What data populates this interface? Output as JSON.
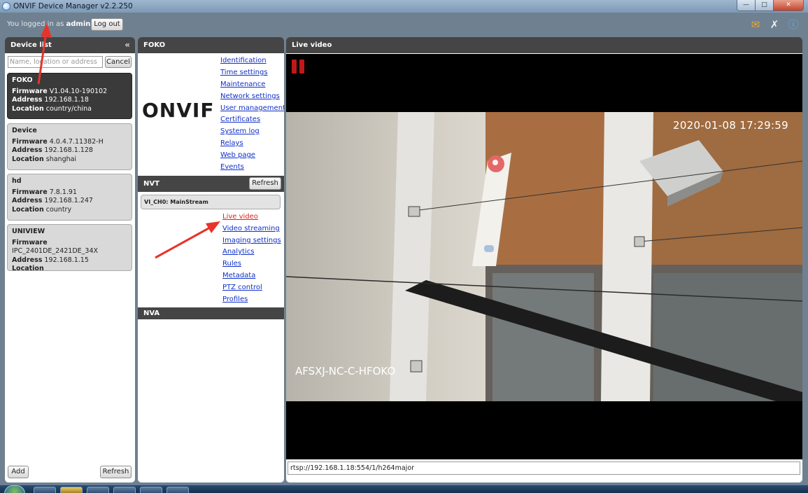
{
  "window": {
    "title": "ONVIF Device Manager v2.2.250"
  },
  "login": {
    "prefix": "You logged in as",
    "user": "admin",
    "logout_label": "Log out"
  },
  "device_list": {
    "header": "Device list",
    "search_placeholder": "Name, location or address",
    "cancel_label": "Cancel",
    "devices": [
      {
        "name": "FOKO",
        "firmware": "V1.04.10-190102",
        "address": "192.168.1.18",
        "location": "country/china"
      },
      {
        "name": "Device",
        "firmware": "4.0.4.7.11382-H",
        "address": "192.168.1.128",
        "location": "shanghai"
      },
      {
        "name": "hd",
        "firmware": "7.8.1.91",
        "address": "192.168.1.247",
        "location": "country"
      },
      {
        "name": "UNIVIEW",
        "firmware": "IPC_2401DE_2421DE_34X",
        "address": "192.168.1.15",
        "location": ""
      }
    ],
    "field_labels": {
      "firmware": "Firmware",
      "address": "Address",
      "location": "Location"
    },
    "add_label": "Add",
    "refresh_label": "Refresh"
  },
  "device_panel": {
    "header": "FOKO",
    "logo_text": "ONVIF",
    "menu": [
      "Identification",
      "Time settings",
      "Maintenance",
      "Network settings",
      "User management",
      "Certificates",
      "System log",
      "Relays",
      "Web page",
      "Events"
    ],
    "nvt_header": "NVT",
    "nvt_refresh_label": "Refresh",
    "stream_name": "VI_CH0: MainStream",
    "stream_menu": [
      "Live video",
      "Video streaming",
      "Imaging settings",
      "Analytics",
      "Rules",
      "Metadata",
      "PTZ control",
      "Profiles"
    ],
    "active_stream_item": "Live video",
    "nva_header": "NVA"
  },
  "live_video": {
    "header": "Live video",
    "timestamp": "2020-01-08  17:29:59",
    "osd_text": "AFSXJ-NC-C-HFOKO",
    "stream_url": "rtsp://192.168.1.18:554/1/h264major"
  },
  "colors": {
    "accent_active": "#e02020",
    "link": "#1030c8",
    "panel_header": "#454545",
    "arrow": "#e8332a"
  }
}
